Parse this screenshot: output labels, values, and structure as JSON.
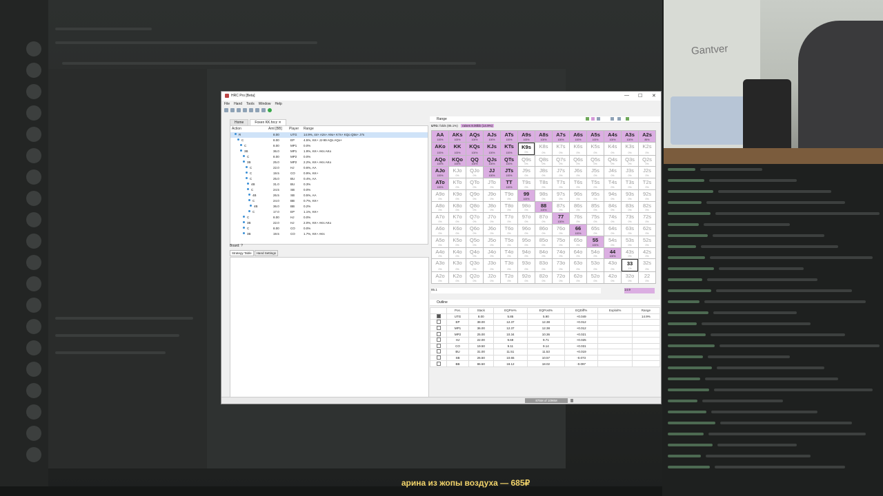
{
  "window": {
    "title": "HRC Pro [Beta]",
    "controls": {
      "minimize": "—",
      "maximize": "☐",
      "close": "✕"
    }
  },
  "menu": [
    "File",
    "Hand",
    "Tools",
    "Window",
    "Help"
  ],
  "tabs": {
    "home": "Home",
    "file": "Foxen KK.hrcz",
    "close": "✕"
  },
  "tree": {
    "headers": {
      "action": "Action",
      "amt": "Amt [BB]",
      "player": "Player",
      "range": "Range"
    },
    "rows": [
      {
        "action": "R",
        "amt": "8.00",
        "player": "UTG",
        "range": "14.9%, 44+ A2s+ A9o+ K7s+ KQo Q5s+ J7s"
      },
      {
        "action": "C",
        "amt": "8.00",
        "player": "EP",
        "range": "4.5%, KK+ JJ-99 AQs AQo+"
      },
      {
        "action": "C",
        "amt": "8.00",
        "player": "MP1",
        "range": "0.0%"
      },
      {
        "action": "3B",
        "amt": "36.0",
        "player": "MP1",
        "range": "1.9%, KK+ AKs AKo"
      },
      {
        "action": "C",
        "amt": "8.00",
        "player": "MP2",
        "range": "0.0%"
      },
      {
        "action": "3B",
        "amt": "25.0",
        "player": "MP2",
        "range": "2.2%, KK+ AKs AKo"
      },
      {
        "action": "C",
        "amt": "22.0",
        "player": "HJ",
        "range": "0.6%, AA"
      },
      {
        "action": "C",
        "amt": "19.5",
        "player": "CO",
        "range": "0.9%, KK+"
      },
      {
        "action": "C",
        "amt": "25.0",
        "player": "BU",
        "range": "0.4%, AA"
      },
      {
        "action": "4B",
        "amt": "31.0",
        "player": "BU",
        "range": "0.3%"
      },
      {
        "action": "C",
        "amt": "24.5",
        "player": "SB",
        "range": "0.0%"
      },
      {
        "action": "4B",
        "amt": "26.5",
        "player": "SB",
        "range": "0.5%, AA"
      },
      {
        "action": "C",
        "amt": "24.0",
        "player": "BB",
        "range": "0.7%, KK+"
      },
      {
        "action": "4B",
        "amt": "36.0",
        "player": "BB",
        "range": "0.2%"
      },
      {
        "action": "C",
        "amt": "17.0",
        "player": "EP",
        "range": "1.1%, KK+"
      },
      {
        "action": "C",
        "amt": "8.00",
        "player": "HJ",
        "range": "0.0%"
      },
      {
        "action": "3B",
        "amt": "22.0",
        "player": "HJ",
        "range": "2.0%, KK+ AKs AKo"
      },
      {
        "action": "C",
        "amt": "8.00",
        "player": "CO",
        "range": "0.0%"
      },
      {
        "action": "3B",
        "amt": "19.5",
        "player": "CO",
        "range": "1.7%, KK+ AKs"
      }
    ]
  },
  "board_label": "Board: ?",
  "strategy_tabs": [
    "Strategy Table",
    "Hand Settings"
  ],
  "range_panel": {
    "title": "Range",
    "utg_label": "UTG:",
    "folds": "folds (85.1%)",
    "raises": "raises 8.00bb (14.9%)",
    "fold_pct": "85.1",
    "raise_pct": "14.9"
  },
  "grid": [
    [
      [
        "AA",
        "100%",
        "on"
      ],
      [
        "AKs",
        "100%",
        "on"
      ],
      [
        "AQs",
        "100%",
        "on"
      ],
      [
        "AJs",
        "100%",
        "on"
      ],
      [
        "ATs",
        "100%",
        "on"
      ],
      [
        "A9s",
        "100%",
        "on"
      ],
      [
        "A8s",
        "100%",
        "on"
      ],
      [
        "A7s",
        "100%",
        "on"
      ],
      [
        "A6s",
        "100%",
        "on"
      ],
      [
        "A5s",
        "100%",
        "on"
      ],
      [
        "A4s",
        "100%",
        "on"
      ],
      [
        "A3s",
        "100%",
        "on"
      ],
      [
        "A2s",
        "89%",
        "on"
      ]
    ],
    [
      [
        "AKo",
        "100%",
        "on"
      ],
      [
        "KK",
        "100%",
        "on"
      ],
      [
        "KQs",
        "100%",
        "on"
      ],
      [
        "KJs",
        "100%",
        "on"
      ],
      [
        "KTs",
        "100%",
        "on"
      ],
      [
        "K9s",
        "0%",
        "mark"
      ],
      [
        "K8s",
        "0%",
        ""
      ],
      [
        "K7s",
        "0%",
        ""
      ],
      [
        "K6s",
        "0%",
        ""
      ],
      [
        "K5s",
        "0%",
        ""
      ],
      [
        "K4s",
        "0%",
        ""
      ],
      [
        "K3s",
        "0%",
        ""
      ],
      [
        "K2s",
        "0%",
        ""
      ]
    ],
    [
      [
        "AQo",
        "100%",
        "on"
      ],
      [
        "KQo",
        "100%",
        "on"
      ],
      [
        "QQ",
        "100%",
        "on"
      ],
      [
        "QJs",
        "100%",
        "on"
      ],
      [
        "QTs",
        "100%",
        "on"
      ],
      [
        "Q9s",
        "0%",
        ""
      ],
      [
        "Q8s",
        "0%",
        ""
      ],
      [
        "Q7s",
        "0%",
        ""
      ],
      [
        "Q6s",
        "0%",
        ""
      ],
      [
        "Q5s",
        "0%",
        ""
      ],
      [
        "Q4s",
        "0%",
        ""
      ],
      [
        "Q3s",
        "0%",
        ""
      ],
      [
        "Q2s",
        "0%",
        ""
      ]
    ],
    [
      [
        "AJo",
        "100%",
        "on"
      ],
      [
        "KJo",
        "0%",
        ""
      ],
      [
        "QJo",
        "0%",
        ""
      ],
      [
        "JJ",
        "100%",
        "on"
      ],
      [
        "JTs",
        "100%",
        "on"
      ],
      [
        "J9s",
        "0%",
        ""
      ],
      [
        "J8s",
        "0%",
        ""
      ],
      [
        "J7s",
        "0%",
        ""
      ],
      [
        "J6s",
        "0%",
        ""
      ],
      [
        "J5s",
        "0%",
        ""
      ],
      [
        "J4s",
        "0%",
        ""
      ],
      [
        "J3s",
        "0%",
        ""
      ],
      [
        "J2s",
        "0%",
        ""
      ]
    ],
    [
      [
        "ATo",
        "100%",
        "on"
      ],
      [
        "KTo",
        "0%",
        ""
      ],
      [
        "QTo",
        "0%",
        ""
      ],
      [
        "JTo",
        "0%",
        ""
      ],
      [
        "TT",
        "100%",
        "on"
      ],
      [
        "T9s",
        "0%",
        ""
      ],
      [
        "T8s",
        "0%",
        ""
      ],
      [
        "T7s",
        "0%",
        ""
      ],
      [
        "T6s",
        "0%",
        ""
      ],
      [
        "T5s",
        "0%",
        ""
      ],
      [
        "T4s",
        "0%",
        ""
      ],
      [
        "T3s",
        "0%",
        ""
      ],
      [
        "T2s",
        "0%",
        ""
      ]
    ],
    [
      [
        "A9o",
        "0%",
        ""
      ],
      [
        "K9o",
        "0%",
        ""
      ],
      [
        "Q9o",
        "0%",
        ""
      ],
      [
        "J9o",
        "0%",
        ""
      ],
      [
        "T9o",
        "0%",
        ""
      ],
      [
        "99",
        "100%",
        "on"
      ],
      [
        "98s",
        "0%",
        ""
      ],
      [
        "97s",
        "0%",
        ""
      ],
      [
        "96s",
        "0%",
        ""
      ],
      [
        "95s",
        "0%",
        ""
      ],
      [
        "94s",
        "0%",
        ""
      ],
      [
        "93s",
        "0%",
        ""
      ],
      [
        "92s",
        "0%",
        ""
      ]
    ],
    [
      [
        "A8o",
        "0%",
        ""
      ],
      [
        "K8o",
        "0%",
        ""
      ],
      [
        "Q8o",
        "0%",
        ""
      ],
      [
        "J8o",
        "0%",
        ""
      ],
      [
        "T8o",
        "0%",
        ""
      ],
      [
        "98o",
        "0%",
        ""
      ],
      [
        "88",
        "100%",
        "on"
      ],
      [
        "87s",
        "0%",
        ""
      ],
      [
        "86s",
        "0%",
        ""
      ],
      [
        "85s",
        "0%",
        ""
      ],
      [
        "84s",
        "0%",
        ""
      ],
      [
        "83s",
        "0%",
        ""
      ],
      [
        "82s",
        "0%",
        ""
      ]
    ],
    [
      [
        "A7o",
        "0%",
        ""
      ],
      [
        "K7o",
        "0%",
        ""
      ],
      [
        "Q7o",
        "0%",
        ""
      ],
      [
        "J7o",
        "0%",
        ""
      ],
      [
        "T7o",
        "0%",
        ""
      ],
      [
        "97o",
        "0%",
        ""
      ],
      [
        "87o",
        "0%",
        ""
      ],
      [
        "77",
        "100%",
        "on"
      ],
      [
        "76s",
        "0%",
        ""
      ],
      [
        "75s",
        "0%",
        ""
      ],
      [
        "74s",
        "0%",
        ""
      ],
      [
        "73s",
        "0%",
        ""
      ],
      [
        "72s",
        "0%",
        ""
      ]
    ],
    [
      [
        "A6o",
        "0%",
        ""
      ],
      [
        "K6o",
        "0%",
        ""
      ],
      [
        "Q6o",
        "0%",
        ""
      ],
      [
        "J6o",
        "0%",
        ""
      ],
      [
        "T6o",
        "0%",
        ""
      ],
      [
        "96o",
        "0%",
        ""
      ],
      [
        "86o",
        "0%",
        ""
      ],
      [
        "76o",
        "0%",
        ""
      ],
      [
        "66",
        "100%",
        "on"
      ],
      [
        "65s",
        "0%",
        ""
      ],
      [
        "64s",
        "0%",
        ""
      ],
      [
        "63s",
        "0%",
        ""
      ],
      [
        "62s",
        "0%",
        ""
      ]
    ],
    [
      [
        "A5o",
        "0%",
        ""
      ],
      [
        "K5o",
        "0%",
        ""
      ],
      [
        "Q5o",
        "0%",
        ""
      ],
      [
        "J5o",
        "0%",
        ""
      ],
      [
        "T5o",
        "0%",
        ""
      ],
      [
        "95o",
        "0%",
        ""
      ],
      [
        "85o",
        "0%",
        ""
      ],
      [
        "75o",
        "0%",
        ""
      ],
      [
        "65o",
        "0%",
        ""
      ],
      [
        "55",
        "100%",
        "on"
      ],
      [
        "54s",
        "0%",
        ""
      ],
      [
        "53s",
        "0%",
        ""
      ],
      [
        "52s",
        "0%",
        ""
      ]
    ],
    [
      [
        "A4o",
        "0%",
        ""
      ],
      [
        "K4o",
        "0%",
        ""
      ],
      [
        "Q4o",
        "0%",
        ""
      ],
      [
        "J4o",
        "0%",
        ""
      ],
      [
        "T4o",
        "0%",
        ""
      ],
      [
        "94o",
        "0%",
        ""
      ],
      [
        "84o",
        "0%",
        ""
      ],
      [
        "74o",
        "0%",
        ""
      ],
      [
        "64o",
        "0%",
        ""
      ],
      [
        "54o",
        "0%",
        ""
      ],
      [
        "44",
        "100%",
        "on"
      ],
      [
        "43s",
        "0%",
        ""
      ],
      [
        "42s",
        "0%",
        ""
      ]
    ],
    [
      [
        "A3o",
        "0%",
        ""
      ],
      [
        "K3o",
        "0%",
        ""
      ],
      [
        "Q3o",
        "0%",
        ""
      ],
      [
        "J3o",
        "0%",
        ""
      ],
      [
        "T3o",
        "0%",
        ""
      ],
      [
        "93o",
        "0%",
        ""
      ],
      [
        "83o",
        "0%",
        ""
      ],
      [
        "73o",
        "0%",
        ""
      ],
      [
        "63o",
        "0%",
        ""
      ],
      [
        "53o",
        "0%",
        ""
      ],
      [
        "43o",
        "0%",
        ""
      ],
      [
        "33",
        "1%",
        "mark"
      ],
      [
        "32s",
        "0%",
        ""
      ]
    ],
    [
      [
        "A2o",
        "0%",
        ""
      ],
      [
        "K2o",
        "0%",
        ""
      ],
      [
        "Q2o",
        "0%",
        ""
      ],
      [
        "J2o",
        "0%",
        ""
      ],
      [
        "T2o",
        "0%",
        ""
      ],
      [
        "92o",
        "0%",
        ""
      ],
      [
        "82o",
        "0%",
        ""
      ],
      [
        "72o",
        "0%",
        ""
      ],
      [
        "62o",
        "0%",
        ""
      ],
      [
        "52o",
        "0%",
        ""
      ],
      [
        "42o",
        "0%",
        ""
      ],
      [
        "32o",
        "0%",
        ""
      ],
      [
        "22",
        "0%",
        ""
      ]
    ]
  ],
  "outline": {
    "title": "Outline",
    "headers": [
      "Pos.",
      "Stack",
      "EQPre%",
      "EQPost%",
      "EQDiff%",
      "Exploit%",
      "Range"
    ],
    "rows": [
      {
        "checked": true,
        "pos": "UTG",
        "stack": "8.00",
        "pre": "5.85",
        "post": "5.90",
        "diff": "+0.049",
        "exploit": "",
        "range": "14.9%"
      },
      {
        "checked": false,
        "pos": "EP",
        "stack": "38.00",
        "pre": "12.37",
        "post": "12.38",
        "diff": "+0.012",
        "exploit": "",
        "range": ""
      },
      {
        "checked": false,
        "pos": "MP1",
        "stack": "36.00",
        "pre": "12.37",
        "post": "12.38",
        "diff": "+0.012",
        "exploit": "",
        "range": ""
      },
      {
        "checked": false,
        "pos": "MP2",
        "stack": "25.00",
        "pre": "10.34",
        "post": "10.36",
        "diff": "+0.021",
        "exploit": "",
        "range": ""
      },
      {
        "checked": false,
        "pos": "HJ",
        "stack": "22.00",
        "pre": "9.69",
        "post": "9.71",
        "diff": "+0.025",
        "exploit": "",
        "range": ""
      },
      {
        "checked": false,
        "pos": "CO",
        "stack": "19.50",
        "pre": "9.11",
        "post": "9.14",
        "diff": "+0.031",
        "exploit": "",
        "range": ""
      },
      {
        "checked": false,
        "pos": "BU",
        "stack": "31.00",
        "pre": "11.51",
        "post": "11.53",
        "diff": "+0.019",
        "exploit": "",
        "range": ""
      },
      {
        "checked": false,
        "pos": "SB",
        "stack": "26.50",
        "pre": "10.65",
        "post": "10.57",
        "diff": "-0.073",
        "exploit": "",
        "range": ""
      },
      {
        "checked": false,
        "pos": "BB",
        "stack": "86.50",
        "pre": "18.12",
        "post": "18.02",
        "diff": "-0.097",
        "exploit": "",
        "range": ""
      }
    ]
  },
  "status": {
    "memory": "875M of 1096M"
  },
  "webcam_text": "Gantver",
  "donation": "арина из жопы воздуха — 685₽"
}
